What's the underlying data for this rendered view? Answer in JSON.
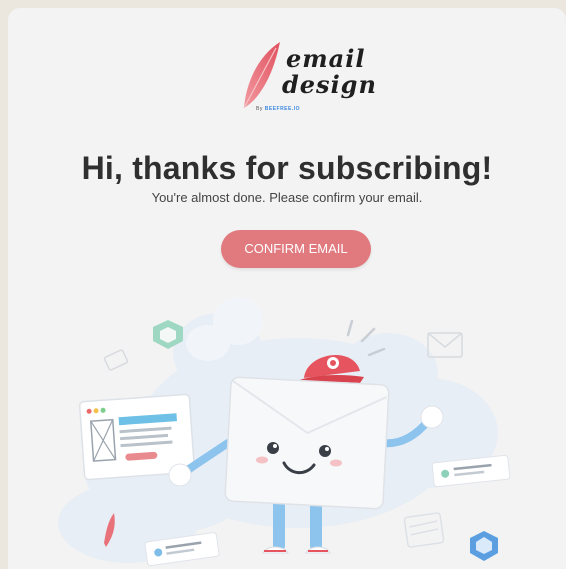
{
  "logo": {
    "word1": "email",
    "word2": "design",
    "by_prefix": "By",
    "by_brand": "BEEFREE.IO"
  },
  "headline": "Hi, thanks for subscribing!",
  "subline": "You're almost done. Please confirm your email.",
  "confirm_button": {
    "label": "CONFIRM EMAIL"
  },
  "colors": {
    "accent": "#e07a7f",
    "background": "#f3f3f3",
    "headline": "#2f2f2f"
  },
  "illustration": {
    "icons": [
      "feather-icon",
      "envelope-mascot-icon",
      "cap-icon",
      "hexagon-icon",
      "browser-window-icon",
      "card-icon"
    ]
  }
}
